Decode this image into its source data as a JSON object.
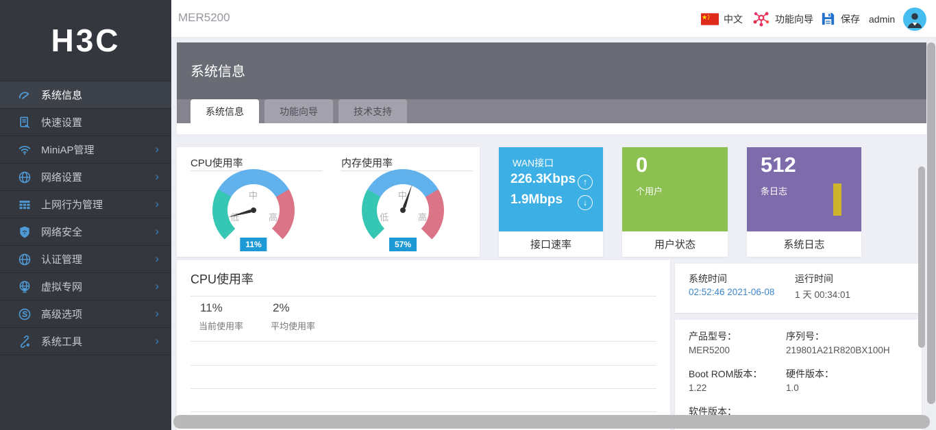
{
  "topbar": {
    "device_name": "MER5200",
    "language": "中文",
    "feature_guide": "功能向导",
    "save": "保存",
    "username": "admin"
  },
  "sidebar": {
    "logo": "H3C",
    "chevron": "›",
    "items": [
      {
        "label": "系统信息",
        "icon": "dashboard-icon",
        "active": true,
        "has_submenu": false
      },
      {
        "label": "快速设置",
        "icon": "quick-setup-icon",
        "active": false,
        "has_submenu": false
      },
      {
        "label": "MiniAP管理",
        "icon": "wifi-icon",
        "active": false,
        "has_submenu": true
      },
      {
        "label": "网络设置",
        "icon": "globe-icon",
        "active": false,
        "has_submenu": true
      },
      {
        "label": "上网行为管理",
        "icon": "table-icon",
        "active": false,
        "has_submenu": true
      },
      {
        "label": "网络安全",
        "icon": "shield-icon",
        "active": false,
        "has_submenu": true
      },
      {
        "label": "认证管理",
        "icon": "globe-icon",
        "active": false,
        "has_submenu": true
      },
      {
        "label": "虚拟专网",
        "icon": "vpn-icon",
        "active": false,
        "has_submenu": true
      },
      {
        "label": "高级选项",
        "icon": "advanced-icon",
        "active": false,
        "has_submenu": true
      },
      {
        "label": "系统工具",
        "icon": "tools-icon",
        "active": false,
        "has_submenu": true
      }
    ]
  },
  "page": {
    "banner_title": "系统信息"
  },
  "tabs": [
    {
      "label": "系统信息",
      "active": true
    },
    {
      "label": "功能向导",
      "active": false
    },
    {
      "label": "技术支持",
      "active": false
    }
  ],
  "gauges": {
    "zone_labels": {
      "low": "低",
      "mid": "中",
      "high": "高"
    },
    "items": [
      {
        "title": "CPU使用率",
        "percent": 11,
        "badge": "11%"
      },
      {
        "title": "内存使用率",
        "percent": 57,
        "badge": "57%"
      }
    ]
  },
  "wan_card": {
    "title": "WAN接口",
    "upload": "226.3Kbps",
    "download": "1.9Mbps",
    "up_arrow": "↑",
    "down_arrow": "↓",
    "footer": "接口速率"
  },
  "user_card": {
    "value": "0",
    "unit": "个用户",
    "footer": "用户状态"
  },
  "log_card": {
    "value": "512",
    "unit": "条日志",
    "footer": "系统日志"
  },
  "cpu_panel": {
    "title": "CPU使用率",
    "stats": [
      {
        "value": "11%",
        "label": "当前使用率"
      },
      {
        "value": "2%",
        "label": "平均使用率"
      }
    ]
  },
  "time_panel": {
    "system_time_label": "系统时间",
    "system_time_value": "02:52:46 2021-06-08",
    "uptime_label": "运行时间",
    "uptime_value": "1 天  00:34:01"
  },
  "device_panel": {
    "fields": [
      {
        "label": "产品型号：",
        "value": "MER5200"
      },
      {
        "label": "序列号：",
        "value": "219801A21R820BX100H"
      },
      {
        "label": "Boot ROM版本：",
        "value": "1.22"
      },
      {
        "label": "硬件版本：",
        "value": "1.0"
      },
      {
        "label": "软件版本：",
        "value": ""
      }
    ]
  },
  "colors": {
    "accent_blue": "#3cafe4",
    "success_green": "#8cc152",
    "log_purple": "#7e6bac",
    "log_bar_yellow": "#ccb42d",
    "badge_blue": "#1d9ad6",
    "gauge_teal": "#35c7b4",
    "gauge_blue": "#61b2ec",
    "gauge_red": "#db7486",
    "link_blue": "#3e87cb",
    "sidebar_bg": "#34373d"
  }
}
